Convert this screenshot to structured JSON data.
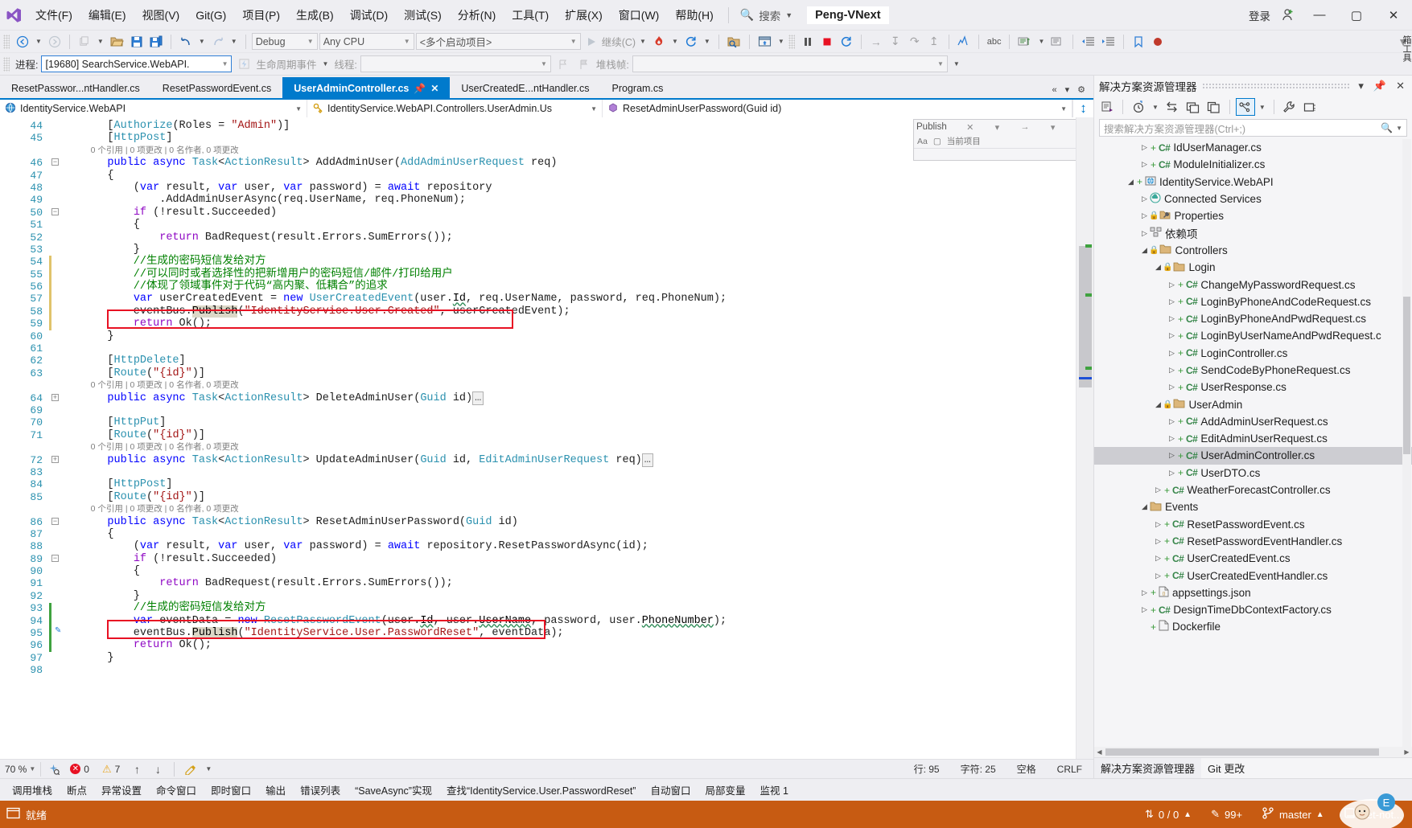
{
  "titlebar": {
    "menus": [
      {
        "label": "文件(F)",
        "key": "F"
      },
      {
        "label": "编辑(E)",
        "key": "E"
      },
      {
        "label": "视图(V)",
        "key": "V"
      },
      {
        "label": "Git(G)",
        "key": "G"
      },
      {
        "label": "项目(P)",
        "key": "P"
      },
      {
        "label": "生成(B)",
        "key": "B"
      },
      {
        "label": "调试(D)",
        "key": "D"
      },
      {
        "label": "测试(S)",
        "key": "S"
      },
      {
        "label": "分析(N)",
        "key": "N"
      },
      {
        "label": "工具(T)",
        "key": "T"
      },
      {
        "label": "扩展(X)",
        "key": "X"
      },
      {
        "label": "窗口(W)",
        "key": "W"
      },
      {
        "label": "帮助(H)",
        "key": "H"
      }
    ],
    "search_label": "搜索",
    "solution_name": "Peng-VNext",
    "signin_label": "登录",
    "minimize": "—",
    "maximize": "▢",
    "close": "✕"
  },
  "toolbar": {
    "config": "Debug",
    "platform": "Any CPU",
    "startup": "<多个启动项目>",
    "continue_label": "继续(C)"
  },
  "toolbar2": {
    "process_label": "进程:",
    "process_value": "[19680] SearchService.WebAPI.",
    "lifecycle_label": "生命周期事件",
    "thread_label": "线程:",
    "stackframe_label": "堆栈帧:"
  },
  "tabs": [
    {
      "label": "ResetPasswor...ntHandler.cs",
      "active": false
    },
    {
      "label": "ResetPasswordEvent.cs",
      "active": false
    },
    {
      "label": "UserAdminController.cs",
      "active": true
    },
    {
      "label": "UserCreatedE...ntHandler.cs",
      "active": false
    },
    {
      "label": "Program.cs",
      "active": false
    }
  ],
  "navbar": {
    "project": "IdentityService.WebAPI",
    "class": "IdentityService.WebAPI.Controllers.UserAdmin.Us",
    "member": "ResetAdminUserPassword(Guid id)"
  },
  "publish_window": {
    "title": "Publish",
    "toolbar_left": "Aa",
    "scope": "当前项目"
  },
  "code_lines": [
    {
      "num": "44",
      "fold": "",
      "marker": "",
      "html": "<span class='pl'>    [</span><span class='typ'>Authorize</span><span class='pl'>(Roles = </span><span class='str'>\"Admin\"</span><span class='pl'>)]</span>"
    },
    {
      "num": "45",
      "fold": "",
      "marker": "",
      "html": "<span class='pl'>    [</span><span class='typ'>HttpPost</span><span class='pl'>]</span>"
    },
    {
      "num": "",
      "fold": "",
      "marker": "",
      "html": "<span class='lens'>    0 个引用 | 0 项更改 | 0 名作者, 0 项更改</span>"
    },
    {
      "num": "46",
      "fold": "-",
      "marker": "",
      "html": "<span class='pl'>    </span><span class='kw'>public</span><span class='pl'> </span><span class='kw'>async</span><span class='pl'> </span><span class='typ'>Task</span><span class='pl'>&lt;</span><span class='typ'>ActionResult</span><span class='pl'>&gt; AddAdminUser(</span><span class='typ'>AddAdminUserRequest</span><span class='pl'> req)</span>"
    },
    {
      "num": "47",
      "fold": "",
      "marker": "",
      "html": "<span class='pl'>    {</span>"
    },
    {
      "num": "48",
      "fold": "",
      "marker": "",
      "html": "<span class='pl'>        (</span><span class='kw'>var</span><span class='pl'> result, </span><span class='kw'>var</span><span class='pl'> user, </span><span class='kw'>var</span><span class='pl'> password) = </span><span class='kw'>await</span><span class='pl'> repository</span>"
    },
    {
      "num": "49",
      "fold": "",
      "marker": "",
      "html": "<span class='pl'>            .AddAdminUserAsync(req.UserName, req.PhoneNum);</span>"
    },
    {
      "num": "50",
      "fold": "-",
      "marker": "",
      "html": "<span class='pl'>        </span><span class='kw2'>if</span><span class='pl'> (!result.Succeeded)</span>"
    },
    {
      "num": "51",
      "fold": "",
      "marker": "",
      "html": "<span class='pl'>        {</span>"
    },
    {
      "num": "52",
      "fold": "",
      "marker": "",
      "html": "<span class='pl'>            </span><span class='kw2'>return</span><span class='pl'> BadRequest(result.Errors.SumErrors());</span>"
    },
    {
      "num": "53",
      "fold": "",
      "marker": "",
      "html": "<span class='pl'>        }</span>"
    },
    {
      "num": "54",
      "fold": "",
      "marker": "ok",
      "html": "<span class='cmt'>        //生成的密码短信发给对方</span>"
    },
    {
      "num": "55",
      "fold": "",
      "marker": "ok",
      "html": "<span class='cmt'>        //可以同时或者选择性的把新增用户的密码短信/邮件/打印给用户</span>"
    },
    {
      "num": "56",
      "fold": "",
      "marker": "ok",
      "html": "<span class='cmt'>        //体现了领域事件对于代码“高内聚、低耦合”的追求</span>"
    },
    {
      "num": "57",
      "fold": "",
      "marker": "ok",
      "html": "<span class='pl'>        </span><span class='kw'>var</span><span class='pl'> userCreatedEvent = </span><span class='kw'>new</span><span class='pl'> </span><span class='typ'>UserCreatedEvent</span><span class='pl'>(user.</span><span class='sq'>Id</span><span class='pl'>, req.UserName, password, req.PhoneNum);</span>"
    },
    {
      "num": "58",
      "fold": "",
      "marker": "ok",
      "html": "<span class='pl'>        eventBus.</span><span class='hl'>Publish</span><span class='pl'>(</span><span class='str'>\"IdentityService.User.Created\"</span><span class='pl'>, userCreatedEvent);</span>"
    },
    {
      "num": "59",
      "fold": "",
      "marker": "ok",
      "html": "<span class='pl'>        </span><span class='kw2'>return</span><span class='pl'> Ok();</span>"
    },
    {
      "num": "60",
      "fold": "",
      "marker": "",
      "html": "<span class='pl'>    }</span>"
    },
    {
      "num": "61",
      "fold": "",
      "marker": "",
      "html": "<span class='pl'></span>"
    },
    {
      "num": "62",
      "fold": "",
      "marker": "",
      "html": "<span class='pl'>    [</span><span class='typ'>HttpDelete</span><span class='pl'>]</span>"
    },
    {
      "num": "63",
      "fold": "",
      "marker": "",
      "html": "<span class='pl'>    [</span><span class='typ'>Route</span><span class='pl'>(</span><span class='str'>\"{id}\"</span><span class='pl'>)]</span>"
    },
    {
      "num": "",
      "fold": "",
      "marker": "",
      "html": "<span class='lens'>    0 个引用 | 0 项更改 | 0 名作者, 0 项更改</span>"
    },
    {
      "num": "64",
      "fold": "+",
      "marker": "",
      "html": "<span class='pl'>    </span><span class='kw'>public</span><span class='pl'> </span><span class='kw'>async</span><span class='pl'> </span><span class='typ'>Task</span><span class='pl'>&lt;</span><span class='typ'>ActionResult</span><span class='pl'>&gt; DeleteAdminUser(</span><span class='typ'>Guid</span><span class='pl'> id)</span><span class='ell'>...</span>"
    },
    {
      "num": "69",
      "fold": "",
      "marker": "",
      "html": "<span class='pl'></span>"
    },
    {
      "num": "70",
      "fold": "",
      "marker": "",
      "html": "<span class='pl'>    [</span><span class='typ'>HttpPut</span><span class='pl'>]</span>"
    },
    {
      "num": "71",
      "fold": "",
      "marker": "",
      "html": "<span class='pl'>    [</span><span class='typ'>Route</span><span class='pl'>(</span><span class='str'>\"{id}\"</span><span class='pl'>)]</span>"
    },
    {
      "num": "",
      "fold": "",
      "marker": "",
      "html": "<span class='lens'>    0 个引用 | 0 项更改 | 0 名作者, 0 项更改</span>"
    },
    {
      "num": "72",
      "fold": "+",
      "marker": "",
      "html": "<span class='pl'>    </span><span class='kw'>public</span><span class='pl'> </span><span class='kw'>async</span><span class='pl'> </span><span class='typ'>Task</span><span class='pl'>&lt;</span><span class='typ'>ActionResult</span><span class='pl'>&gt; UpdateAdminUser(</span><span class='typ'>Guid</span><span class='pl'> id, </span><span class='typ'>EditAdminUserRequest</span><span class='pl'> req)</span><span class='ell'>...</span>"
    },
    {
      "num": "83",
      "fold": "",
      "marker": "",
      "html": "<span class='pl'></span>"
    },
    {
      "num": "84",
      "fold": "",
      "marker": "",
      "html": "<span class='pl'>    [</span><span class='typ'>HttpPost</span><span class='pl'>]</span>"
    },
    {
      "num": "85",
      "fold": "",
      "marker": "",
      "html": "<span class='pl'>    [</span><span class='typ'>Route</span><span class='pl'>(</span><span class='str'>\"{id}\"</span><span class='pl'>)]</span>"
    },
    {
      "num": "",
      "fold": "",
      "marker": "",
      "html": "<span class='lens'>    0 个引用 | 0 项更改 | 0 名作者, 0 项更改</span>"
    },
    {
      "num": "86",
      "fold": "-",
      "marker": "",
      "html": "<span class='pl'>    </span><span class='kw'>public</span><span class='pl'> </span><span class='kw'>async</span><span class='pl'> </span><span class='typ'>Task</span><span class='pl'>&lt;</span><span class='typ'>ActionResult</span><span class='pl'>&gt; ResetAdminUserPassword(</span><span class='typ'>Guid</span><span class='pl'> id)</span>"
    },
    {
      "num": "87",
      "fold": "",
      "marker": "",
      "html": "<span class='pl'>    {</span>"
    },
    {
      "num": "88",
      "fold": "",
      "marker": "",
      "html": "<span class='pl'>        (</span><span class='kw'>var</span><span class='pl'> result, </span><span class='kw'>var</span><span class='pl'> user, </span><span class='kw'>var</span><span class='pl'> password) = </span><span class='kw'>await</span><span class='pl'> repository.ResetPasswordAsync(id);</span>"
    },
    {
      "num": "89",
      "fold": "-",
      "marker": "",
      "html": "<span class='pl'>        </span><span class='kw2'>if</span><span class='pl'> (!result.Succeeded)</span>"
    },
    {
      "num": "90",
      "fold": "",
      "marker": "",
      "html": "<span class='pl'>        {</span>"
    },
    {
      "num": "91",
      "fold": "",
      "marker": "",
      "html": "<span class='pl'>            </span><span class='kw2'>return</span><span class='pl'> BadRequest(result.Errors.SumErrors());</span>"
    },
    {
      "num": "92",
      "fold": "",
      "marker": "",
      "html": "<span class='pl'>        }</span>"
    },
    {
      "num": "93",
      "fold": "",
      "marker": "save",
      "html": "<span class='cmt'>        //生成的密码短信发给对方</span>"
    },
    {
      "num": "94",
      "fold": "",
      "marker": "save",
      "html": "<span class='pl'>        </span><span class='kw'>var</span><span class='pl'> eventData = </span><span class='kw'>new</span><span class='pl'> </span><span class='typ'>ResetPasswordEvent</span><span class='pl'>(user.</span><span class='sq'>Id</span><span class='pl'>, user.</span><span class='sq'>UserName</span><span class='pl'>, password, user.</span><span class='sq'>PhoneNumber</span><span class='pl'>);</span>"
    },
    {
      "num": "95",
      "fold": "",
      "marker": "save",
      "pencil": true,
      "html": "<span class='pl'>        eventBus.</span><span class='hl'>Publish</span><span class='pl'>(</span><span class='str'>\"IdentityService.User.PasswordReset\"</span><span class='pl'>, eventData);</span>"
    },
    {
      "num": "96",
      "fold": "",
      "marker": "save",
      "html": "<span class='pl'>        </span><span class='kw2'>return</span><span class='pl'> Ok();</span>"
    },
    {
      "num": "97",
      "fold": "",
      "marker": "",
      "html": "<span class='pl'>    }</span>"
    },
    {
      "num": "98",
      "fold": "",
      "marker": "",
      "html": "<span class='pl'></span>"
    }
  ],
  "editor_status": {
    "zoom": "70 %",
    "errors": "0",
    "warnings": "7",
    "line_label": "行: 95",
    "col_label": "字符: 25",
    "space_label": "空格",
    "eol_label": "CRLF"
  },
  "solution_explorer": {
    "title": "解决方案资源管理器",
    "search_placeholder": "搜索解决方案资源管理器(Ctrl+;)",
    "tabs": [
      {
        "label": "解决方案资源管理器",
        "active": true
      },
      {
        "label": "Git 更改",
        "active": false
      }
    ],
    "tree": [
      {
        "label": "IdUserManager.cs",
        "indent": 3,
        "arrow": "▷",
        "kind": "cs",
        "plus": true
      },
      {
        "label": "ModuleInitializer.cs",
        "indent": 3,
        "arrow": "▷",
        "kind": "cs",
        "plus": true
      },
      {
        "label": "IdentityService.WebAPI",
        "indent": 2,
        "arrow": "◢",
        "kind": "web",
        "plus": true,
        "bold": false
      },
      {
        "label": "Connected Services",
        "indent": 3,
        "arrow": "▷",
        "kind": "cloud"
      },
      {
        "label": "Properties",
        "indent": 3,
        "arrow": "▷",
        "kind": "props",
        "lock": true
      },
      {
        "label": "依赖项",
        "indent": 3,
        "arrow": "▷",
        "kind": "deps"
      },
      {
        "label": "Controllers",
        "indent": 3,
        "arrow": "◢",
        "kind": "folder",
        "lock": true
      },
      {
        "label": "Login",
        "indent": 4,
        "arrow": "◢",
        "kind": "folder",
        "lock": true
      },
      {
        "label": "ChangeMyPasswordRequest.cs",
        "indent": 5,
        "arrow": "▷",
        "kind": "cs",
        "plus": true
      },
      {
        "label": "LoginByPhoneAndCodeRequest.cs",
        "indent": 5,
        "arrow": "▷",
        "kind": "cs",
        "plus": true
      },
      {
        "label": "LoginByPhoneAndPwdRequest.cs",
        "indent": 5,
        "arrow": "▷",
        "kind": "cs",
        "plus": true
      },
      {
        "label": "LoginByUserNameAndPwdRequest.c",
        "indent": 5,
        "arrow": "▷",
        "kind": "cs",
        "plus": true
      },
      {
        "label": "LoginController.cs",
        "indent": 5,
        "arrow": "▷",
        "kind": "cs",
        "plus": true
      },
      {
        "label": "SendCodeByPhoneRequest.cs",
        "indent": 5,
        "arrow": "▷",
        "kind": "cs",
        "plus": true
      },
      {
        "label": "UserResponse.cs",
        "indent": 5,
        "arrow": "▷",
        "kind": "cs",
        "plus": true
      },
      {
        "label": "UserAdmin",
        "indent": 4,
        "arrow": "◢",
        "kind": "folder",
        "lock": true
      },
      {
        "label": "AddAdminUserRequest.cs",
        "indent": 5,
        "arrow": "▷",
        "kind": "cs",
        "plus": true
      },
      {
        "label": "EditAdminUserRequest.cs",
        "indent": 5,
        "arrow": "▷",
        "kind": "cs",
        "plus": true
      },
      {
        "label": "UserAdminController.cs",
        "indent": 5,
        "arrow": "▷",
        "kind": "cs",
        "plus": true,
        "selected": true
      },
      {
        "label": "UserDTO.cs",
        "indent": 5,
        "arrow": "▷",
        "kind": "cs",
        "plus": true
      },
      {
        "label": "WeatherForecastController.cs",
        "indent": 4,
        "arrow": "▷",
        "kind": "cs",
        "plus": true
      },
      {
        "label": "Events",
        "indent": 3,
        "arrow": "◢",
        "kind": "folder"
      },
      {
        "label": "ResetPasswordEvent.cs",
        "indent": 4,
        "arrow": "▷",
        "kind": "cs",
        "plus": true
      },
      {
        "label": "ResetPasswordEventHandler.cs",
        "indent": 4,
        "arrow": "▷",
        "kind": "cs",
        "plus": true
      },
      {
        "label": "UserCreatedEvent.cs",
        "indent": 4,
        "arrow": "▷",
        "kind": "cs",
        "plus": true
      },
      {
        "label": "UserCreatedEventHandler.cs",
        "indent": 4,
        "arrow": "▷",
        "kind": "cs",
        "plus": true
      },
      {
        "label": "appsettings.json",
        "indent": 3,
        "arrow": "▷",
        "kind": "json",
        "plus": true
      },
      {
        "label": "DesignTimeDbContextFactory.cs",
        "indent": 3,
        "arrow": "▷",
        "kind": "cs",
        "plus": true
      },
      {
        "label": "Dockerfile",
        "indent": 3,
        "arrow": "",
        "kind": "file",
        "plus": true
      }
    ]
  },
  "bottom_tabs": [
    "调用堆栈",
    "断点",
    "异常设置",
    "命令窗口",
    "即时窗口",
    "输出",
    "错误列表",
    "“SaveAsync”实现",
    "查找“IdentityService.User.PasswordReset”",
    "自动窗口",
    "局部变量",
    "监视 1"
  ],
  "statusbar": {
    "ready": "就绪",
    "updown": "0 / 0",
    "notifications": "99+",
    "branch": "master",
    "repo": "net-not..."
  }
}
